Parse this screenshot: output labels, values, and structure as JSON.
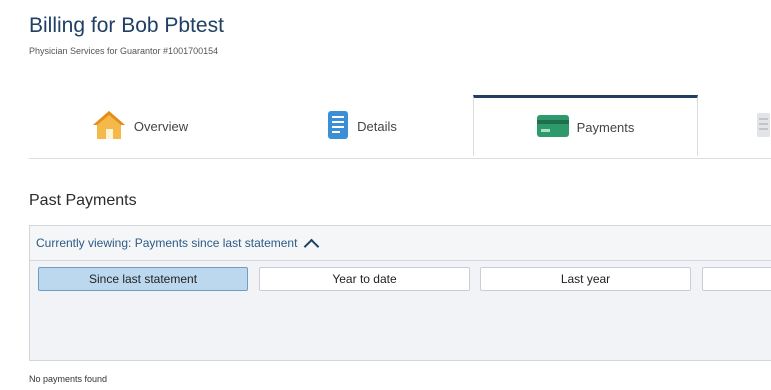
{
  "header": {
    "title": "Billing for Bob Pbtest",
    "subtitle": "Physician Services for Guarantor #1001700154"
  },
  "tabs": [
    {
      "label": "Overview",
      "icon": "house-icon"
    },
    {
      "label": "Details",
      "icon": "document-icon"
    },
    {
      "label": "Payments",
      "icon": "credit-card-icon",
      "active": true
    },
    {
      "label": "",
      "icon": "statement-icon"
    }
  ],
  "payments": {
    "section_title": "Past Payments",
    "viewing_label": "Currently viewing: Payments since last statement",
    "filters": [
      {
        "label": "Since last statement",
        "selected": true
      },
      {
        "label": "Year to date",
        "selected": false
      },
      {
        "label": "Last year",
        "selected": false
      },
      {
        "label": "",
        "selected": false
      }
    ],
    "empty_message": "No payments found"
  },
  "colors": {
    "brand": "#1f3f63",
    "link": "#2d5a86",
    "selected_filter": "#bcd8ef",
    "card_icon": "#2e9a6c",
    "house_roof": "#f0a02a",
    "doc_icon": "#3a8fd6"
  }
}
